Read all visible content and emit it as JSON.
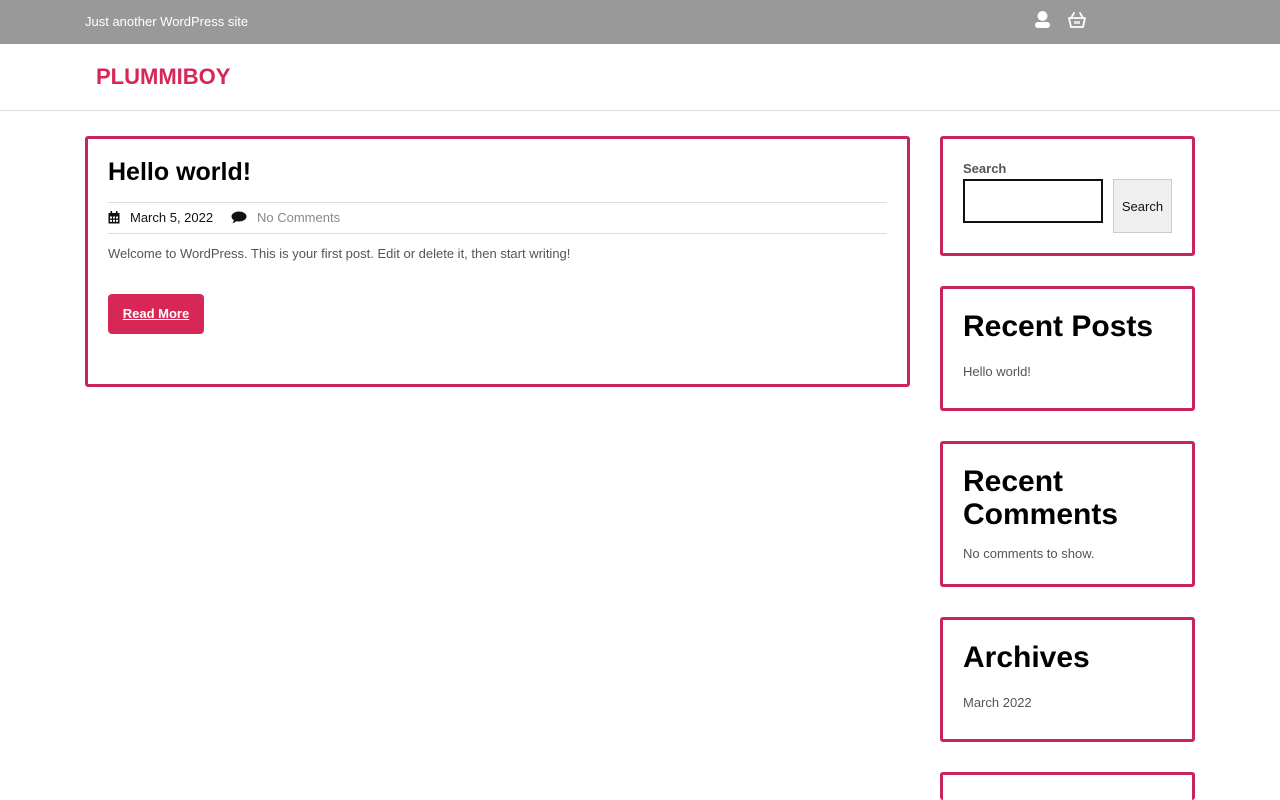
{
  "topbar": {
    "tagline": "Just another WordPress site",
    "icons": [
      "user-icon",
      "shopping-basket-icon"
    ]
  },
  "header": {
    "site_title": "PLUMMIBOY"
  },
  "post": {
    "title": "Hello world!",
    "date": "March 5, 2022",
    "comments": "No Comments",
    "excerpt": "Welcome to WordPress. This is your first post. Edit or delete it, then start writing!",
    "read_more": "Read More"
  },
  "sidebar": {
    "search": {
      "label": "Search",
      "placeholder": "",
      "button": "Search"
    },
    "recent_posts": {
      "title": "Recent Posts",
      "items": [
        "Hello world!"
      ]
    },
    "recent_comments": {
      "title": "Recent Comments",
      "empty_text": "No comments to show."
    },
    "archives": {
      "title": "Archives",
      "items": [
        "March 2022"
      ]
    }
  },
  "colors": {
    "accent": "#d62757",
    "card_border": "#c9245b",
    "topbar": "#999999"
  }
}
